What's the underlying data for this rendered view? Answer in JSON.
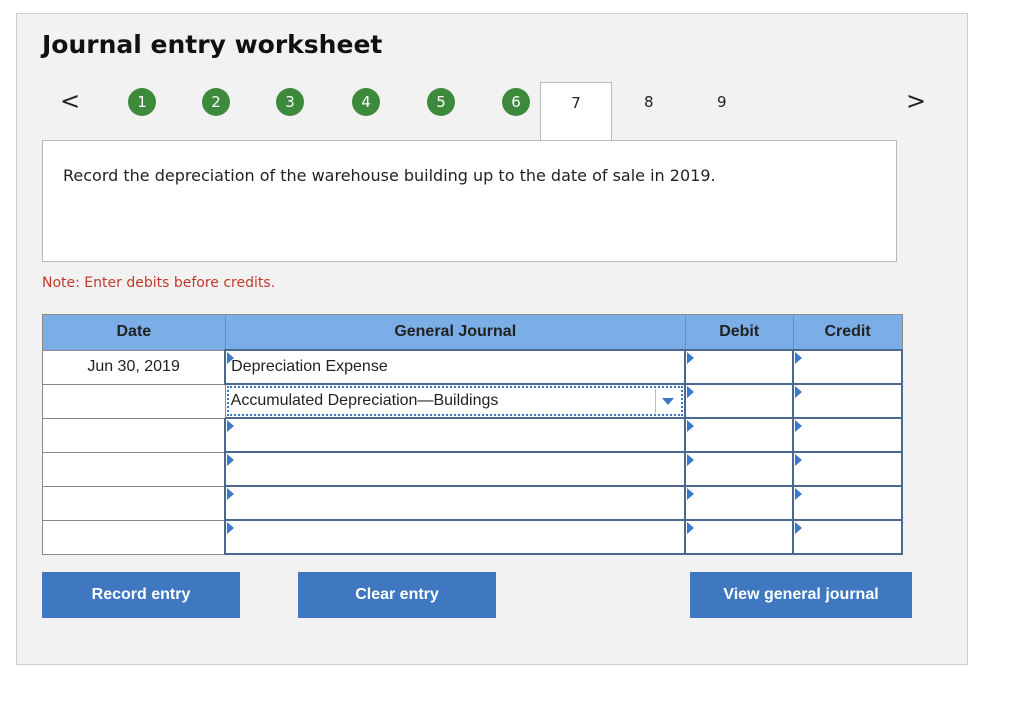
{
  "worksheet": {
    "title": "Journal entry worksheet"
  },
  "steps": {
    "prev_icon": "chevron-left-icon",
    "next_icon": "chevron-right-icon",
    "prev_symbol": "<",
    "next_symbol": ">",
    "completed": [
      "1",
      "2",
      "3",
      "4",
      "5",
      "6"
    ],
    "current": "7",
    "upcoming": [
      "8",
      "9"
    ],
    "completed_color": "#3d8a3d"
  },
  "instruction": {
    "text": "Record the depreciation of the warehouse building up to the date of sale in 2019."
  },
  "note": {
    "text": "Note: Enter debits before credits.",
    "color": "#c0392b"
  },
  "table": {
    "headers": {
      "date": "Date",
      "journal": "General Journal",
      "debit": "Debit",
      "credit": "Credit"
    },
    "header_color": "#7baee6",
    "rows": [
      {
        "date": "Jun 30, 2019",
        "account": "Depreciation Expense",
        "debit": "",
        "credit": ""
      },
      {
        "date": "",
        "account": "Accumulated Depreciation—Buildings",
        "debit": "",
        "credit": ""
      },
      {
        "date": "",
        "account": "",
        "debit": "",
        "credit": ""
      },
      {
        "date": "",
        "account": "",
        "debit": "",
        "credit": ""
      },
      {
        "date": "",
        "account": "",
        "debit": "",
        "credit": ""
      },
      {
        "date": "",
        "account": "",
        "debit": "",
        "credit": ""
      }
    ]
  },
  "buttons": {
    "record": "Record entry",
    "clear": "Clear entry",
    "view": "View general journal",
    "color": "#3f78c0"
  }
}
